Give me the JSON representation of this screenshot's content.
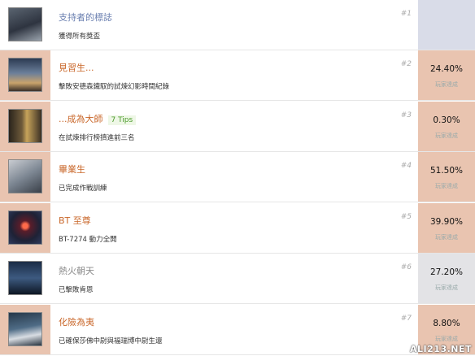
{
  "colors": {
    "left_strip_unlocked": "#e9c4b0",
    "right_strip_unlocked": "#e9c4b0",
    "right_strip_special": "#d9dce8",
    "right_strip_gray": "#e3e3e6",
    "title_orange": "#c9672a",
    "title_blue": "#6a7fb0",
    "title_gray": "#8a8a8a"
  },
  "achievements": [
    {
      "title": "支持者的標誌",
      "tip": "",
      "desc": "獲得所有獎盃",
      "num": "#1",
      "percent": "",
      "percent_label": "",
      "title_color": "blue",
      "left": "none",
      "right": "special",
      "icon": "titanfall-logo-icon"
    },
    {
      "title": "見習生...",
      "tip": "",
      "desc": "擊敗安德森鐵馭的試煉幻影時間紀錄",
      "num": "#2",
      "percent": "24.40%",
      "percent_label": "玩家達成",
      "title_color": "orange",
      "left": "orange",
      "right": "orange",
      "icon": "pilot-gauntlet-icon"
    },
    {
      "title": "...成為大師",
      "tip": "7 Tips",
      "desc": "在試煉排行榜擠進前三名",
      "num": "#3",
      "percent": "0.30%",
      "percent_label": "玩家達成",
      "title_color": "orange",
      "left": "orange",
      "right": "orange",
      "icon": "tower-icon"
    },
    {
      "title": "畢業生",
      "tip": "",
      "desc": "已完成作戰訓練",
      "num": "#4",
      "percent": "51.50%",
      "percent_label": "玩家達成",
      "title_color": "orange",
      "left": "orange",
      "right": "orange",
      "icon": "soldier-icon"
    },
    {
      "title": "BT 至尊",
      "tip": "",
      "desc": "BT-7274 動力全開",
      "num": "#5",
      "percent": "39.90%",
      "percent_label": "玩家達成",
      "title_color": "orange",
      "left": "orange",
      "right": "orange",
      "icon": "titan-eye-icon"
    },
    {
      "title": "熱火朝天",
      "tip": "",
      "desc": "已擊敗肯恩",
      "num": "#6",
      "percent": "27.20%",
      "percent_label": "玩家達成",
      "title_color": "gray",
      "left": "none",
      "right": "gray",
      "icon": "kane-icon"
    },
    {
      "title": "化險為夷",
      "tip": "",
      "desc": "已確保莎佛中尉與福瑞博中尉生還",
      "num": "#7",
      "percent": "8.80%",
      "percent_label": "玩家達成",
      "title_color": "orange",
      "left": "orange",
      "right": "orange",
      "icon": "battle-scene-icon"
    }
  ],
  "watermark": "ALI213.NET"
}
